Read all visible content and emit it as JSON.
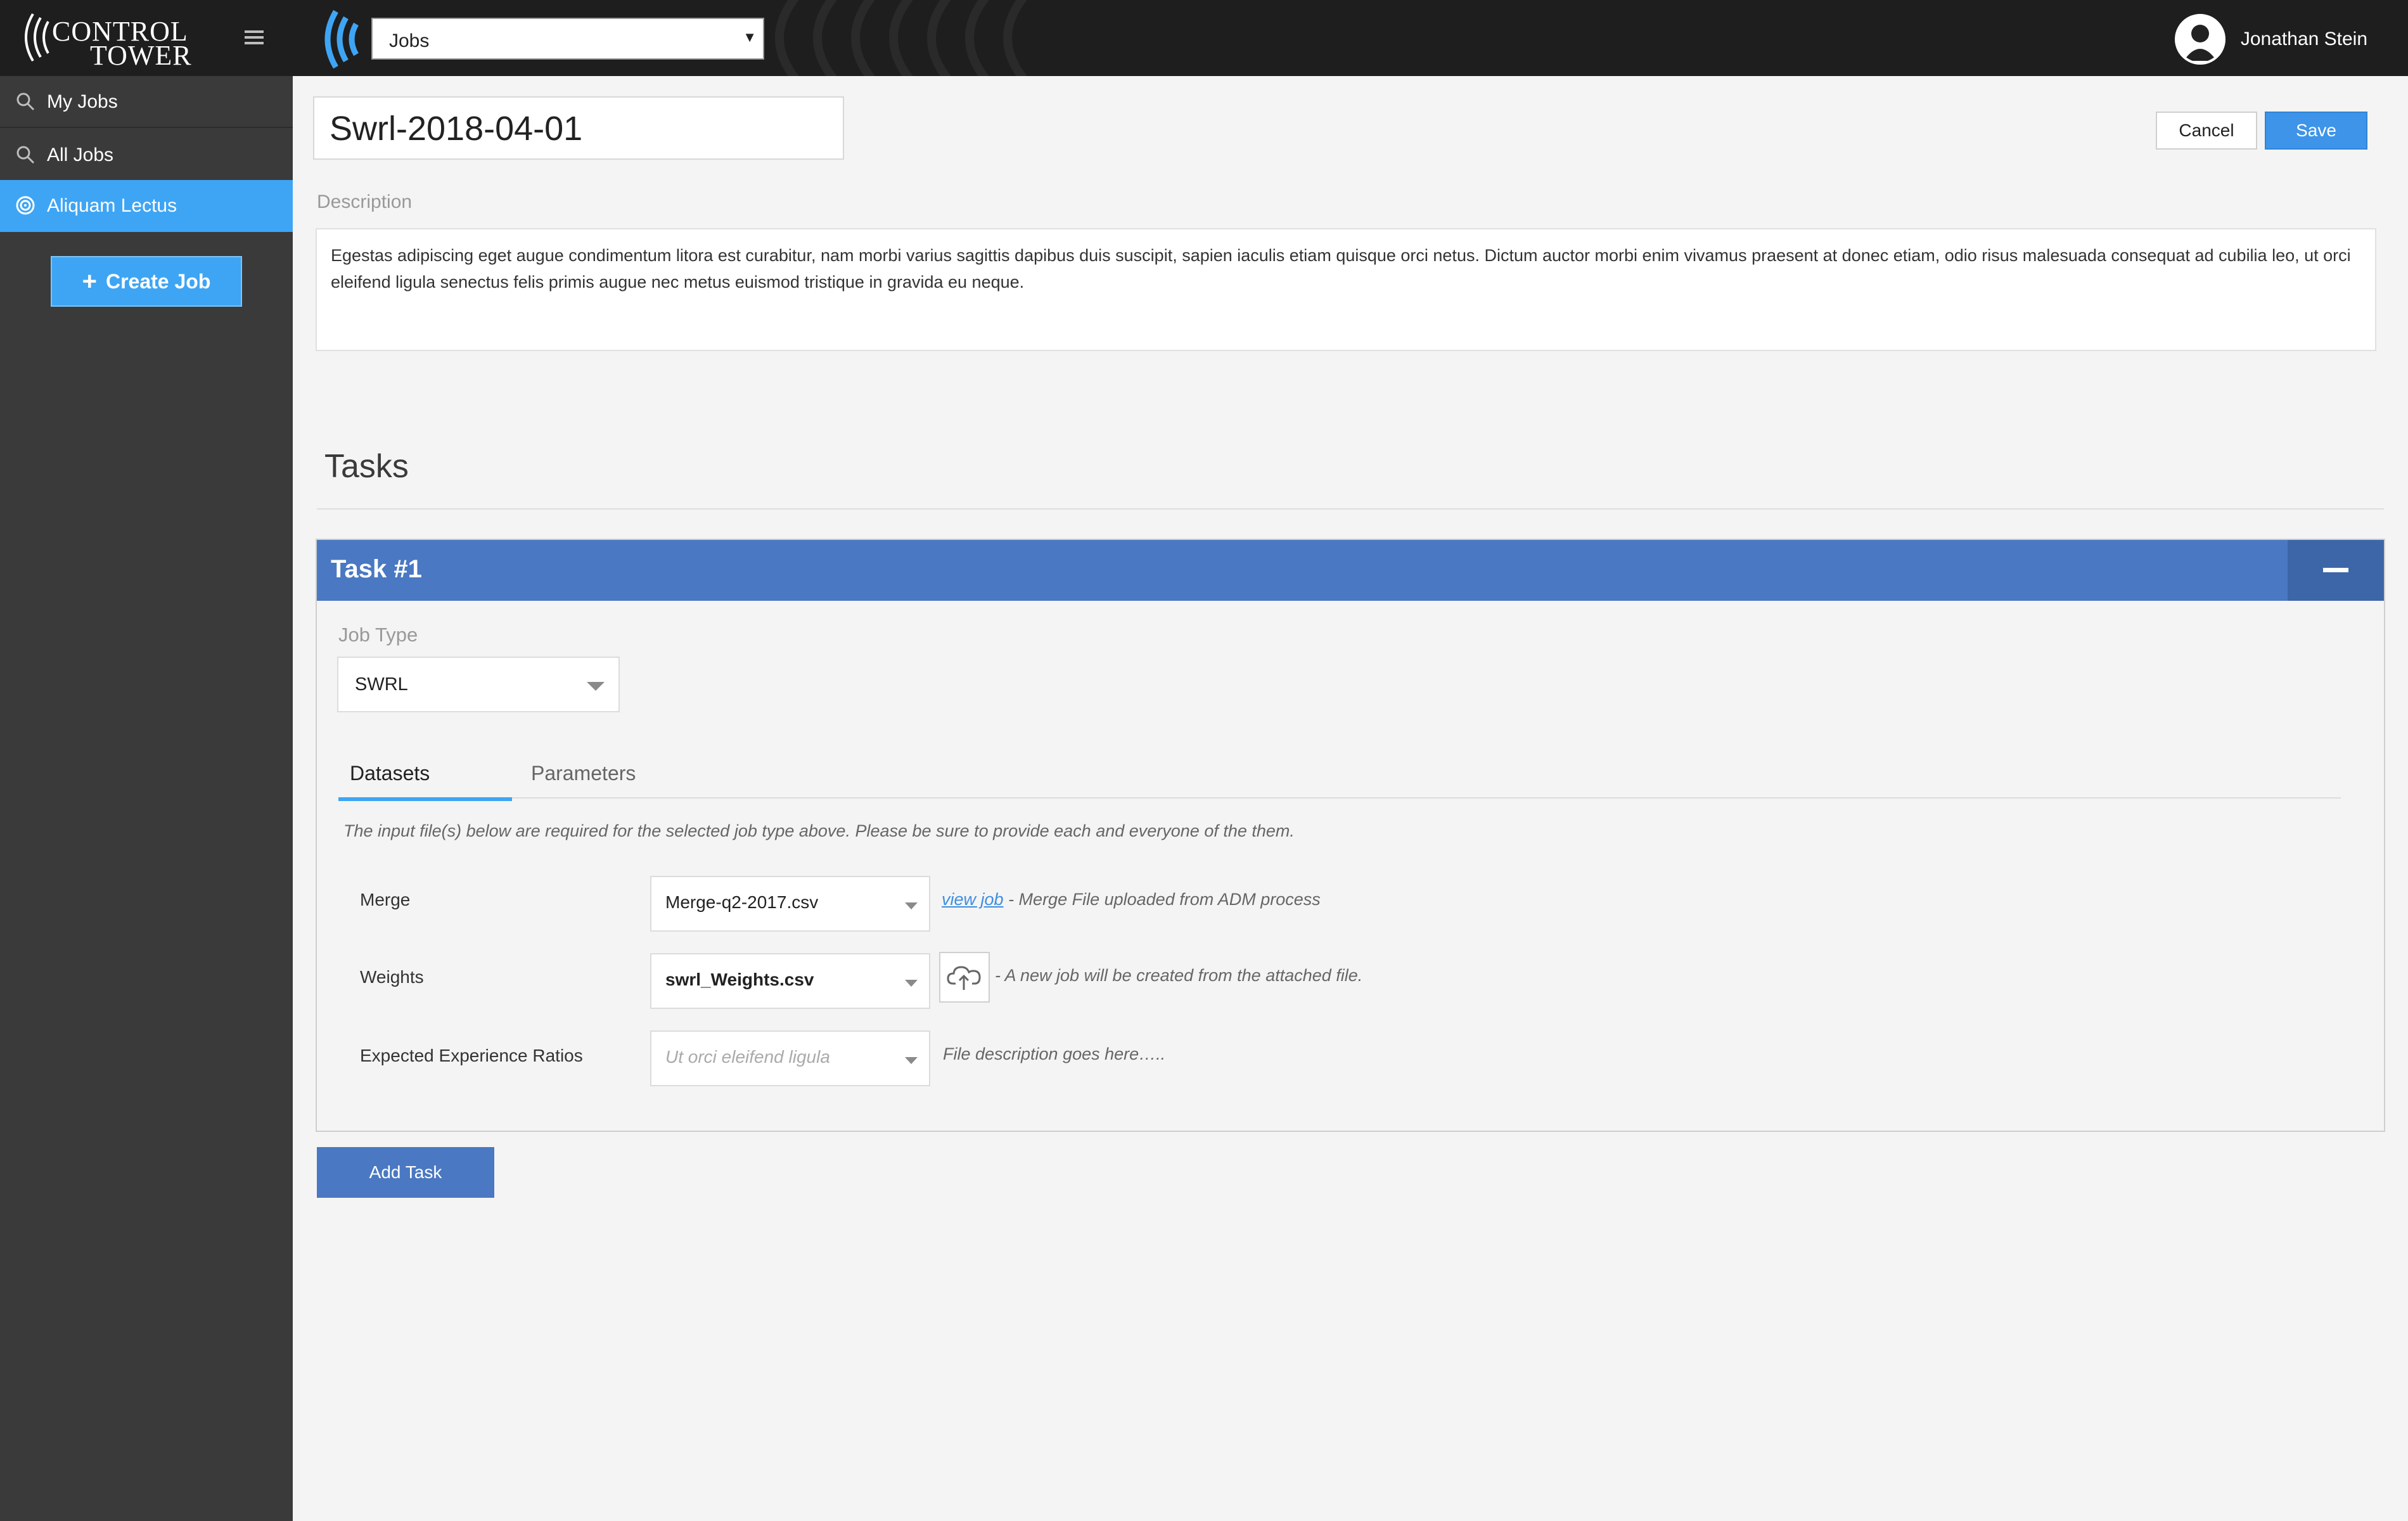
{
  "app": {
    "logo_line1": "CONTROL",
    "logo_line2": "TOWER"
  },
  "topbar": {
    "section_select": "Jobs",
    "user_name": "Jonathan Stein"
  },
  "sidebar": {
    "items": [
      {
        "label": "My Jobs",
        "icon": "search-icon"
      },
      {
        "label": "All Jobs",
        "icon": "search-icon"
      },
      {
        "label": "Aliquam Lectus",
        "icon": "target-icon",
        "active": true
      }
    ],
    "create_button": "Create Job"
  },
  "job": {
    "title": "Swrl-2018-04-01",
    "description_label": "Description",
    "description": "Egestas adipiscing eget augue condimentum litora est curabitur, nam morbi varius sagittis dapibus duis suscipit, sapien iaculis etiam quisque orci netus.  Dictum auctor morbi enim vivamus praesent at donec etiam, odio risus malesuada consequat ad cubilia leo, ut orci eleifend ligula senectus felis primis augue nec metus euismod tristique in gravida eu neque."
  },
  "actions": {
    "cancel": "Cancel",
    "save": "Save"
  },
  "tasks": {
    "heading": "Tasks",
    "task": {
      "title": "Task #1",
      "job_type_label": "Job Type",
      "job_type_value": "SWRL",
      "tabs": [
        "Datasets",
        "Parameters"
      ],
      "active_tab": "Datasets",
      "hint": "The input file(s) below are required for the selected job type above. Please be sure to provide each and everyone of the them.",
      "inputs": [
        {
          "label": "Merge",
          "value": "Merge-q2-2017.csv",
          "link": "view job",
          "note": "-  Merge File uploaded from ADM process"
        },
        {
          "label": "Weights",
          "value": "swrl_Weights.csv",
          "note": "- A new job will be created from the attached file."
        },
        {
          "label": "Expected Experience Ratios",
          "placeholder": "Ut orci eleifend ligula",
          "note": "File description goes here….."
        }
      ]
    },
    "add_task": "Add Task"
  },
  "colors": {
    "accent": "#3ea5f4",
    "task_header": "#4a78c2",
    "save": "#3e94e8"
  }
}
